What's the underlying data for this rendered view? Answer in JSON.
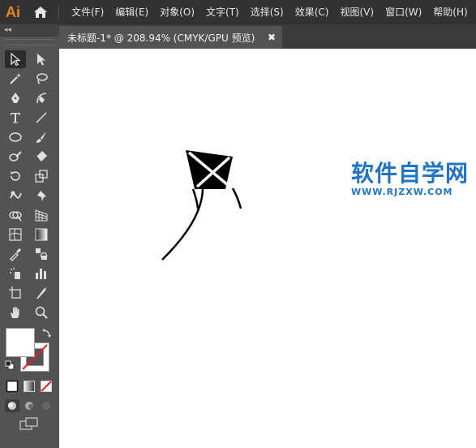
{
  "app": {
    "logo_text": "Ai",
    "menu": [
      "文件(F)",
      "编辑(E)",
      "对象(O)",
      "文字(T)",
      "选择(S)",
      "效果(C)",
      "视图(V)",
      "窗口(W)",
      "帮助(H)"
    ]
  },
  "panel": {
    "collapse_glyph": "◂◂"
  },
  "document": {
    "tab_title": "未标题-1* @ 208.94% (CMYK/GPU 预览)",
    "close_glyph": "✖"
  },
  "watermark": {
    "title": "软件自学网",
    "url": "WWW.RJZXW.COM"
  },
  "colors": {
    "menubar": "#323232",
    "panel": "#535353",
    "accent_logo": "#e8871e",
    "watermark": "#1f74c5"
  },
  "tools": [
    {
      "name": "selection-tool-icon"
    },
    {
      "name": "direct-selection-tool-icon"
    },
    {
      "name": "magic-wand-tool-icon"
    },
    {
      "name": "lasso-tool-icon"
    },
    {
      "name": "pen-tool-icon"
    },
    {
      "name": "curvature-tool-icon"
    },
    {
      "name": "type-tool-icon"
    },
    {
      "name": "line-segment-tool-icon"
    },
    {
      "name": "ellipse-tool-icon"
    },
    {
      "name": "paintbrush-tool-icon"
    },
    {
      "name": "shaper-tool-icon"
    },
    {
      "name": "eraser-tool-icon"
    },
    {
      "name": "rotate-tool-icon"
    },
    {
      "name": "scale-tool-icon"
    },
    {
      "name": "warp-tool-icon"
    },
    {
      "name": "puppet-warp-tool-icon"
    },
    {
      "name": "shape-builder-tool-icon"
    },
    {
      "name": "perspective-grid-tool-icon"
    },
    {
      "name": "mesh-tool-icon"
    },
    {
      "name": "gradient-tool-icon"
    },
    {
      "name": "eyedropper-tool-icon"
    },
    {
      "name": "blend-tool-icon"
    },
    {
      "name": "symbol-sprayer-tool-icon"
    },
    {
      "name": "column-graph-tool-icon"
    },
    {
      "name": "artboard-tool-icon"
    },
    {
      "name": "slice-tool-icon"
    },
    {
      "name": "hand-tool-icon"
    },
    {
      "name": "zoom-tool-icon"
    }
  ]
}
